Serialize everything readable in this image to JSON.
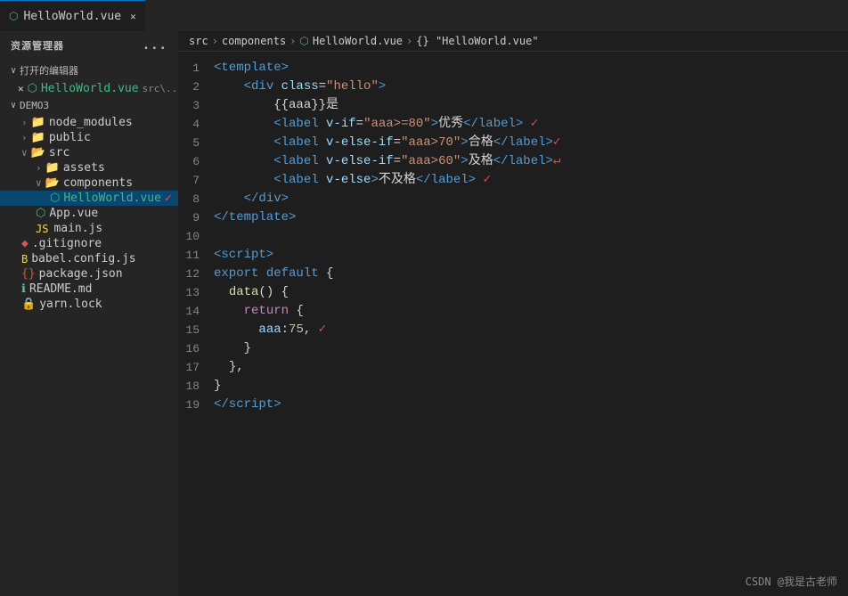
{
  "sidebar": {
    "header": "资源管理器",
    "dots": "...",
    "opened_editors_label": "打开的编辑器",
    "opened_files": [
      {
        "name": "HelloWorld.vue",
        "path": "src\\...",
        "icon": "vue"
      }
    ],
    "tree_label": "DEMO3",
    "items": [
      {
        "id": "node_modules",
        "label": "node_modules",
        "type": "folder",
        "depth": 1
      },
      {
        "id": "public",
        "label": "public",
        "type": "folder",
        "depth": 1
      },
      {
        "id": "src",
        "label": "src",
        "type": "folder",
        "depth": 1,
        "open": true
      },
      {
        "id": "assets",
        "label": "assets",
        "type": "folder",
        "depth": 2
      },
      {
        "id": "components",
        "label": "components",
        "type": "folder",
        "depth": 2,
        "open": true
      },
      {
        "id": "HelloWorld.vue",
        "label": "HelloWorld.vue",
        "type": "vue",
        "depth": 3,
        "active": true
      },
      {
        "id": "App.vue",
        "label": "App.vue",
        "type": "vue",
        "depth": 2
      },
      {
        "id": "main.js",
        "label": "main.js",
        "type": "js",
        "depth": 2
      },
      {
        "id": ".gitignore",
        "label": ".gitignore",
        "type": "git",
        "depth": 1
      },
      {
        "id": "babel.config.js",
        "label": "babel.config.js",
        "type": "babel",
        "depth": 1
      },
      {
        "id": "package.json",
        "label": "package.json",
        "type": "package",
        "depth": 1
      },
      {
        "id": "README.md",
        "label": "README.md",
        "type": "readme",
        "depth": 1
      },
      {
        "id": "yarn.lock",
        "label": "yarn.lock",
        "type": "lock",
        "depth": 1
      }
    ]
  },
  "tab": {
    "filename": "HelloWorld.vue",
    "icon": "vue"
  },
  "breadcrumb": {
    "src": "src",
    "components": "components",
    "file": "HelloWorld.vue",
    "symbol": "{} \"HelloWorld.vue\""
  },
  "code": {
    "lines": [
      {
        "num": 1,
        "html": "<span class='c-tag'>&lt;template&gt;</span>"
      },
      {
        "num": 2,
        "html": "    <span class='c-tag'>&lt;div</span> <span class='c-attr'>class</span><span class='c-punct'>=</span><span class='c-string'>\"hello\"</span><span class='c-tag'>&gt;</span>"
      },
      {
        "num": 3,
        "html": "        <span class='c-mustache'>{{aaa}}</span><span class='c-chinese'>是</span>"
      },
      {
        "num": 4,
        "html": "        <span class='c-tag'>&lt;label</span> <span class='c-vif'>v-if</span><span class='c-punct'>=</span><span class='c-vstr'>\"aaa&gt;=80\"</span><span class='c-tag'>&gt;</span><span class='c-chinese'>优秀</span><span class='c-tag'>&lt;/label&gt;</span> <span class='checkmark'>✓</span>"
      },
      {
        "num": 5,
        "html": "        <span class='c-tag'>&lt;label</span> <span class='c-vif'>v-else-if</span><span class='c-punct'>=</span><span class='c-vstr'>\"aaa&gt;70\"</span><span class='c-tag'>&gt;</span><span class='c-chinese'>合格</span><span class='c-tag'>&lt;/label&gt;</span><span class='checkmark'>✓</span>"
      },
      {
        "num": 6,
        "html": "        <span class='c-tag'>&lt;label</span> <span class='c-vif'>v-else-if</span><span class='c-punct'>=</span><span class='c-vstr'>\"aaa&gt;60\"</span><span class='c-tag'>&gt;</span><span class='c-chinese'>及格</span><span class='c-tag'>&lt;/label&gt;</span><span class='checkmark'>↵</span>"
      },
      {
        "num": 7,
        "html": "        <span class='c-tag'>&lt;label</span> <span class='c-vif'>v-else</span><span class='c-tag'>&gt;</span><span class='c-chinese'>不及格</span><span class='c-tag'>&lt;/label&gt;</span> <span class='checkmark'>✓</span>"
      },
      {
        "num": 8,
        "html": "    <span class='c-tag'>&lt;/div&gt;</span>"
      },
      {
        "num": 9,
        "html": "<span class='c-tag'>&lt;/template&gt;</span>"
      },
      {
        "num": 10,
        "html": ""
      },
      {
        "num": 11,
        "html": "<span class='c-tag'>&lt;script&gt;</span>"
      },
      {
        "num": 12,
        "html": "<span class='c-export'>export</span> <span class='c-default'>default</span> <span class='c-punct'>{</span>"
      },
      {
        "num": 13,
        "html": "  <span class='c-func'>data</span><span class='c-punct'>()</span> <span class='c-punct'>{</span>"
      },
      {
        "num": 14,
        "html": "    <span class='c-return'>return</span> <span class='c-punct'>{</span>"
      },
      {
        "num": 15,
        "html": "      <span class='c-prop'>aaa</span><span class='c-punct'>:</span><span class='c-number'>75</span><span class='c-punct'>,</span> <span class='checkmark'>✓</span>"
      },
      {
        "num": 16,
        "html": "    <span class='c-punct'>}</span>"
      },
      {
        "num": 17,
        "html": "  <span class='c-punct'>},</span>"
      },
      {
        "num": 18,
        "html": "<span class='c-punct'>}</span>"
      },
      {
        "num": 19,
        "html": "<span class='c-tag'>&lt;/script&gt;</span>"
      }
    ]
  },
  "watermark": "CSDN @我是古老师"
}
